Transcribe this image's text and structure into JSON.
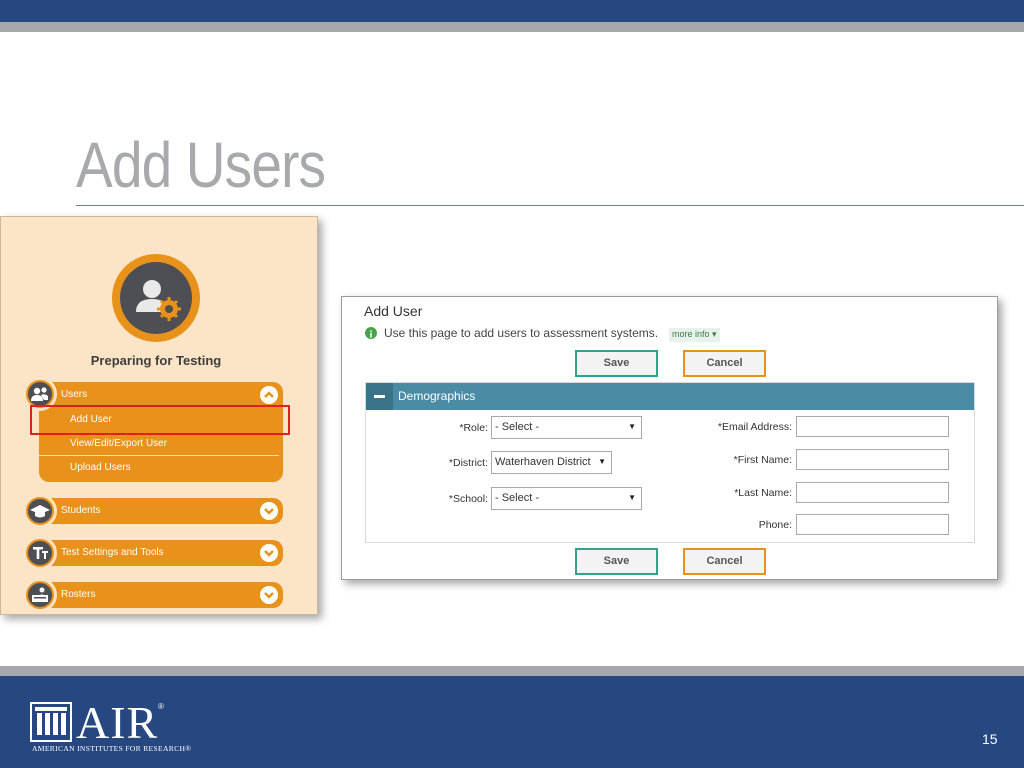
{
  "slide": {
    "title": "Add Users",
    "page_number": "15",
    "logo_word": "AIR",
    "logo_registered": "®",
    "logo_subtitle": "American Institutes for Research®",
    "colors": {
      "navy": "#274780",
      "gray_rule": "#a6a8ab",
      "title_gray": "#a7a9ac"
    }
  },
  "nav": {
    "heading": "Preparing for Testing",
    "accent": "#e8921c",
    "groups": [
      {
        "label": "Users",
        "icon": "users-icon",
        "toggle": "chevron-up-icon",
        "items": [
          {
            "label": "Add User",
            "selected": true
          },
          {
            "label": "View/Edit/Export User"
          },
          {
            "label": "Upload Users"
          }
        ]
      },
      {
        "label": "Students",
        "icon": "graduation-cap-icon",
        "toggle": "chevron-down-icon"
      },
      {
        "label": "Test Settings and Tools",
        "icon": "text-tools-icon",
        "toggle": "chevron-down-icon"
      },
      {
        "label": "Rosters",
        "icon": "roster-icon",
        "toggle": "chevron-down-icon"
      }
    ]
  },
  "form": {
    "title": "Add User",
    "info_text": "Use this page to add users to assessment systems.",
    "more_info": "more info ▾",
    "save_label": "Save",
    "cancel_label": "Cancel",
    "section_title": "Demographics",
    "fields": {
      "role": {
        "label": "*Role:",
        "value": "- Select -"
      },
      "district": {
        "label": "*District:",
        "value": "Waterhaven District"
      },
      "school": {
        "label": "*School:",
        "value": "- Select -"
      },
      "email": {
        "label": "*Email Address:",
        "value": ""
      },
      "first_name": {
        "label": "*First Name:",
        "value": ""
      },
      "last_name": {
        "label": "*Last Name:",
        "value": ""
      },
      "phone": {
        "label": "Phone:",
        "value": ""
      }
    }
  }
}
